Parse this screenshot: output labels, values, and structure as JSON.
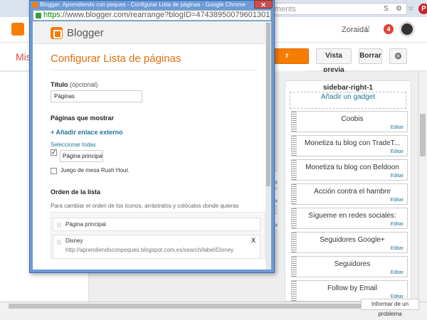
{
  "background": {
    "url_fragment": "eelements",
    "extensions": [
      "sb-icon",
      "settings-icon"
    ],
    "user_name": "Zoraida",
    "notification_count": "4",
    "page_heading": "Mis",
    "buttons": {
      "save": "r disposición",
      "preview": "Vista previa",
      "clear": "Borrar"
    },
    "sidebar": {
      "title": "sidebar-right-1",
      "add_gadget": "Añadir un gadget",
      "edit_label": "Editar",
      "gadgets": [
        "Coobis",
        "Monetiza tu blog con TradeT...",
        "Monetiza tu blog con Beldoon",
        "Acción contra el hambre",
        "Sígueme en redes sociales:",
        "Seguidores Google+",
        "Seguidores",
        "Follow by Email"
      ]
    },
    "report_problem": "Informar de un problema"
  },
  "popup": {
    "window_title": "Blogger: Aprendiendo con peques - Configurar Lista de páginas - Google Chrome",
    "url_scheme": "https",
    "url_rest": "://www.blogger.com/rearrange?blogID=47438950079601301358&secti",
    "brand": "Blogger",
    "heading": "Configurar Lista de páginas",
    "title_label": "Título",
    "title_optional": "(opcional)",
    "title_value": "Páginas",
    "pages_label": "Páginas que mostrar",
    "add_external_link": "+ Añadir enlace externo",
    "select_all": "Seleccionar todas",
    "pages": [
      {
        "name": "Página principal",
        "checked": true
      },
      {
        "name": "Juego de mesa Rush Hour.",
        "checked": false
      }
    ],
    "order_label": "Orden de la lista",
    "order_note": "Para cambiar el orden de los iconos, arrástralos y colócalos donde quieras",
    "order_items": [
      {
        "name": "Página principal",
        "url": ""
      },
      {
        "name": "Disney",
        "url": "http://aprendiendoconpeques.blogspot.com.es/search/label/Disney"
      }
    ],
    "remove_symbol": "X",
    "checkmark": "✓"
  }
}
